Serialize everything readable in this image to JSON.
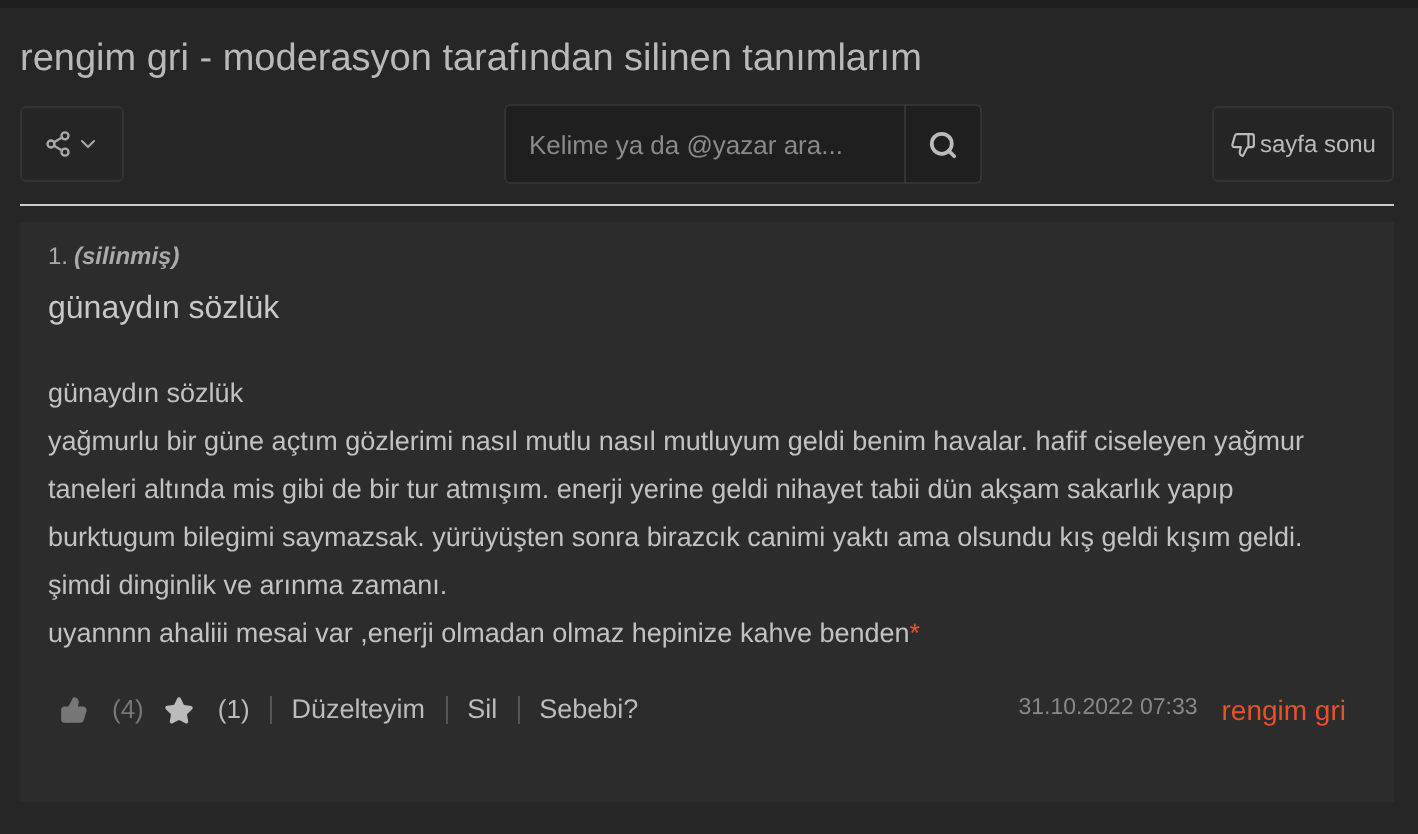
{
  "page_title": "rengim gri - moderasyon tarafından silinen tanımlarım",
  "search": {
    "placeholder": "Kelime ya da @yazar ara..."
  },
  "page_end_button": "sayfa sonu",
  "entry": {
    "number": "1.",
    "status": "(silinmiş)",
    "topic": "günaydın sözlük",
    "paragraphs": [
      "günaydın sözlük",
      "yağmurlu bir güne açtım gözlerimi nasıl mutlu nasıl mutluyum geldi benim havalar. hafif ciseleyen yağmur taneleri altında mis gibi de bir tur atmışım. enerji yerine geldi nihayet tabii dün akşam sakarlık yapıp burktugum bilegimi saymazsak. yürüyüşten sonra birazcık canimi yaktı ama olsundu kış geldi kışım geldi. şimdi dinginlik ve arınma zamanı.",
      "uyannnn ahaliii mesai var ,enerji olmadan olmaz hepinize kahve benden"
    ],
    "footnote_mark": "*",
    "votes": "(4)",
    "favorites": "(1)",
    "actions": [
      "Düzelteyim",
      "Sil",
      "Sebebi?"
    ],
    "date": "31.10.2022 07:33",
    "author": "rengim gri"
  }
}
